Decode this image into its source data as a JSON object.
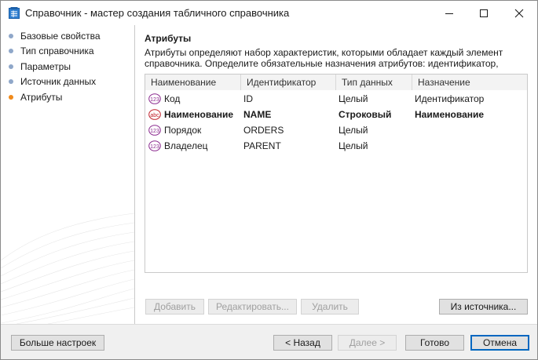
{
  "window": {
    "title": "Справочник - мастер создания табличного справочника",
    "icon": "document-table-icon",
    "controls": {
      "minimize": "minimize-icon",
      "maximize": "maximize-icon",
      "close": "close-icon"
    }
  },
  "sidebar": {
    "items": [
      {
        "label": "Базовые свойства",
        "active": false
      },
      {
        "label": "Тип справочника",
        "active": false
      },
      {
        "label": "Параметры",
        "active": false
      },
      {
        "label": "Источник данных",
        "active": false
      },
      {
        "label": "Атрибуты",
        "active": true
      }
    ]
  },
  "page": {
    "heading": "Атрибуты",
    "description": "Атрибуты определяют набор характеристик, которыми обладает каждый элемент справочника. Определите обязательные назначения атрибутов: идентификатор,"
  },
  "table": {
    "columns": [
      "Наименование",
      "Идентификатор",
      "Тип данных",
      "Назначение"
    ],
    "rows": [
      {
        "icon": "numeric-type-icon",
        "name": "Код",
        "id": "ID",
        "type": "Целый",
        "purpose": "Идентификатор",
        "bold": false
      },
      {
        "icon": "string-type-icon",
        "name": "Наименование",
        "id": "NAME",
        "type": "Строковый",
        "purpose": "Наименование",
        "bold": true
      },
      {
        "icon": "numeric-type-icon",
        "name": "Порядок",
        "id": "ORDERS",
        "type": "Целый",
        "purpose": "",
        "bold": false
      },
      {
        "icon": "numeric-type-icon",
        "name": "Владелец",
        "id": "PARENT",
        "type": "Целый",
        "purpose": "",
        "bold": false
      }
    ]
  },
  "actions": {
    "add": "Добавить",
    "edit": "Редактировать...",
    "delete": "Удалить",
    "from_source": "Из источника..."
  },
  "footer": {
    "more_settings": "Больше настроек",
    "back": "< Назад",
    "next": "Далее >",
    "done": "Готово",
    "cancel": "Отмена"
  },
  "colors": {
    "accent": "#0067c0",
    "active_step": "#f08a1a",
    "inactive_step": "#8fa7c9",
    "numeric_icon": "#8b2a8f",
    "string_icon": "#c0202a"
  }
}
